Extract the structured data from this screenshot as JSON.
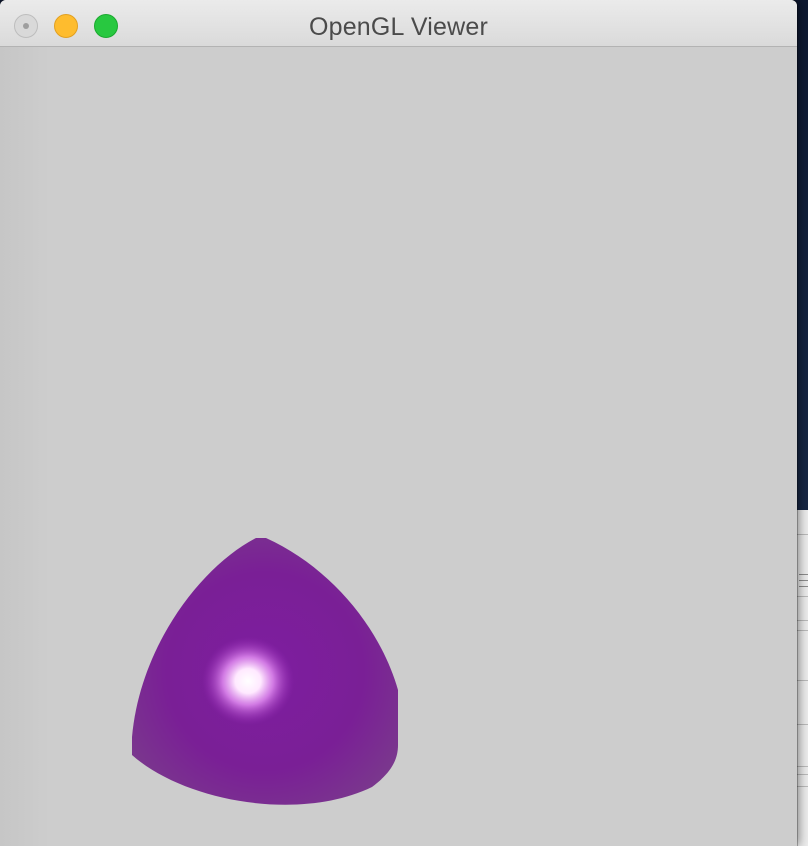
{
  "window": {
    "title": "OpenGL Viewer",
    "controls": [
      "close-button",
      "minimize-button",
      "zoom-button"
    ]
  },
  "viewport": {
    "background_color": "#cdcdcd",
    "object": {
      "shape": "sphere-octant",
      "color": "#7b1f99",
      "highlight_color": "#ffffff"
    }
  },
  "colors": {
    "close": "#d9d9d9",
    "minimize": "#febc2e",
    "zoom": "#28c840"
  }
}
